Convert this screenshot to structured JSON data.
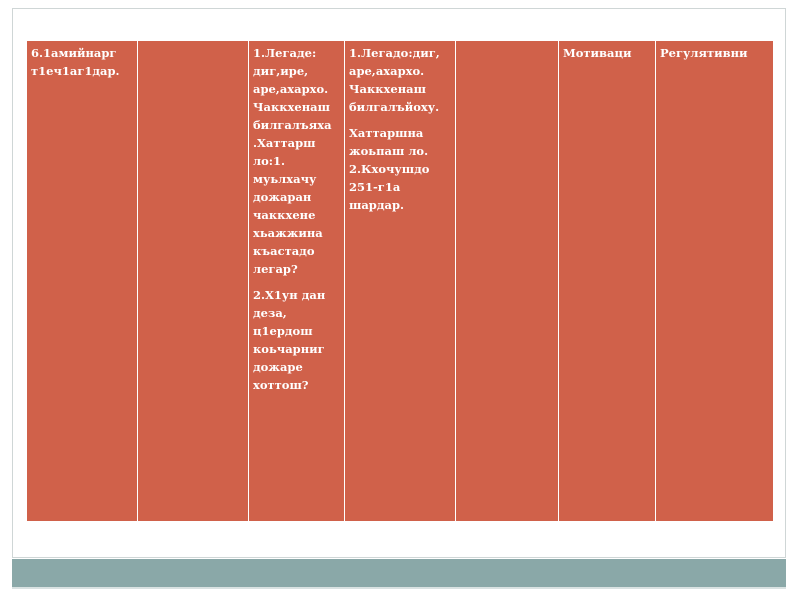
{
  "table": {
    "columns": [
      {
        "paragraphs": [
          "6.1амийнарг т1еч1аг1дар."
        ]
      },
      {
        "paragraphs": []
      },
      {
        "paragraphs": [
          "1.Легаде: диг,ире, аре,ахархо. Чаккхенаш билгалъяха .Хаттарш ло:1. муьлхачу дожаран чаккхене хьажжина къастадо легар?",
          "2.Х1ун дан деза, ц1ердош коьчарниг дожаре хоттош?"
        ]
      },
      {
        "paragraphs": [
          "1.Легадо:диг, аре,ахархо. Чаккхенаш билгалъйоху.",
          "Хаттаршна жоьпаш ло. 2.Кхочушдо 251-г1а шардар."
        ]
      },
      {
        "paragraphs": []
      },
      {
        "paragraphs": [
          "Мотиваци"
        ]
      },
      {
        "paragraphs": [
          "Регулятивни"
        ]
      }
    ]
  },
  "colors": {
    "cell_fill": "#d0614a",
    "border": "#ffffff",
    "bottom_bar": "#8aa8a8"
  }
}
